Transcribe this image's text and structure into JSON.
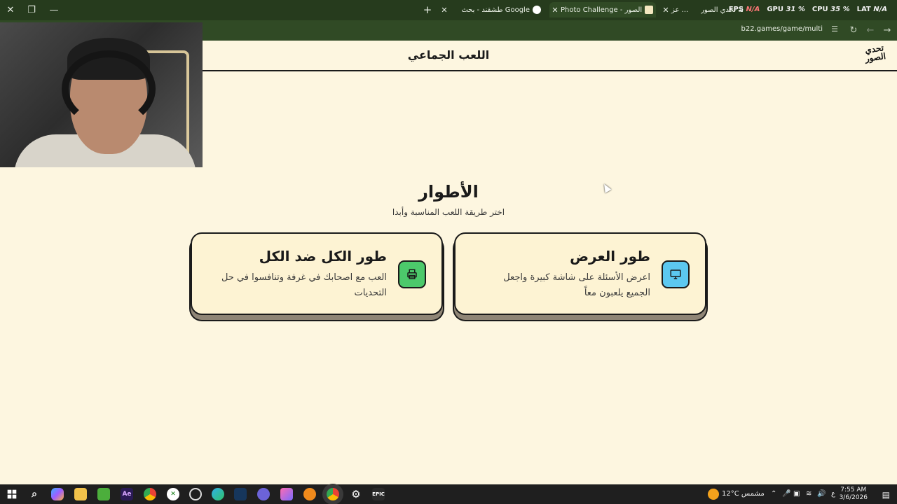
{
  "browser": {
    "tabs": [
      {
        "title": "طشقند - بحث Google",
        "active": false
      },
      {
        "title": "Photo Challenge - تحدي الصور",
        "active": true
      },
      {
        "title": "عز ...",
        "active": false
      },
      {
        "title": "بطولة تحدي الصور",
        "active": false
      }
    ],
    "new_tab_label": "+",
    "perf": {
      "fps_label": "FPS",
      "fps_value": "N/A",
      "gpu_label": "GPU",
      "gpu_value": "31 %",
      "cpu_label": "CPU",
      "cpu_value": "35 %",
      "lat_label": "LAT",
      "lat_value": "N/A"
    },
    "url": "b22.games/game/multi"
  },
  "page": {
    "logo_text": "تحدي الصور",
    "header_title": "اللعب الجماعي",
    "modes_title": "الأطوار",
    "modes_subtitle": "اختر طريقة اللعب المناسبة وأبدا",
    "cards": [
      {
        "title": "طور العرض",
        "description": "اعرض الأسئلة على شاشة كبيرة واجعل الجميع يلعبون معاً",
        "icon": "monitor-icon",
        "color": "#5cc8f0"
      },
      {
        "title": "طور الكل ضد الكل",
        "description": "العب مع اصحابك في غرفة وتنافسوا في حل التحديات",
        "icon": "printer-icon",
        "color": "#4cc96b"
      }
    ]
  },
  "taskbar": {
    "weather": "12°C مشمس",
    "lang": "ع",
    "time": "7:55 AM",
    "date": "3/6/2026",
    "icons": [
      "windows-start-icon",
      "search-icon",
      "copilot-icon",
      "file-explorer-icon",
      "minecraft-icon",
      "after-effects-icon",
      "chrome-icon",
      "xbox-icon",
      "github-icon",
      "edge-icon",
      "steam-icon",
      "discord-icon",
      "photos-icon",
      "blender-icon",
      "chrome-active-icon",
      "settings-icon",
      "epic-games-icon"
    ]
  }
}
